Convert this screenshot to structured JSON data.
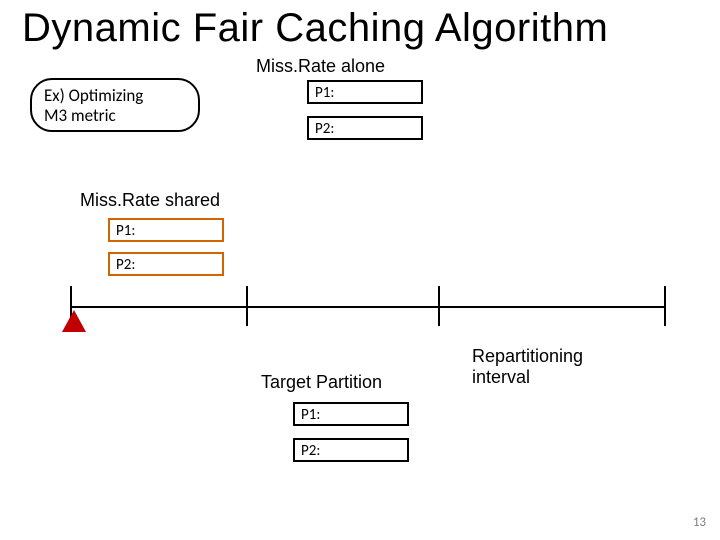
{
  "title": "Dynamic Fair Caching Algorithm",
  "missrate_alone": {
    "label": "Miss.Rate alone",
    "p1": "P1:",
    "p2": "P2:"
  },
  "optimizing_box": {
    "line1": "Ex) Optimizing",
    "line2": "M3 metric"
  },
  "missrate_shared": {
    "label": "Miss.Rate shared",
    "p1": "P1:",
    "p2": "P2:"
  },
  "target_partition": {
    "label": "Target Partition",
    "p1": "P1:",
    "p2": "P2:"
  },
  "repartition": {
    "line1": "Repartitioning",
    "line2": "interval"
  },
  "page_number": "13"
}
